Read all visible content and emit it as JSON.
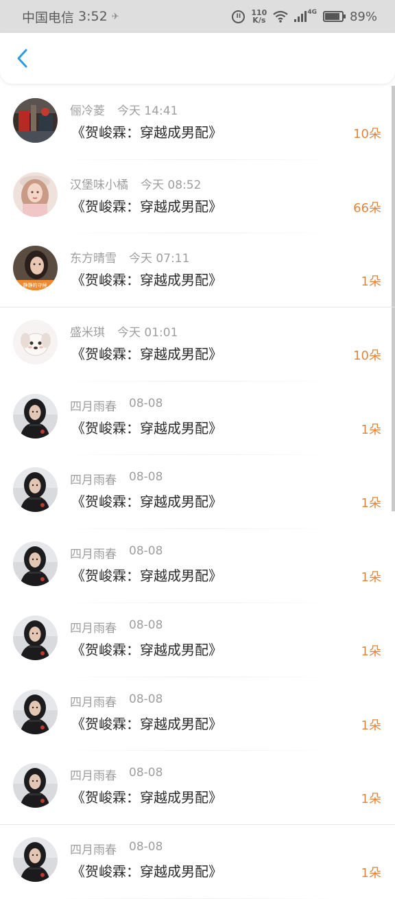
{
  "status_bar": {
    "carrier": "中国电信",
    "time": "3:52",
    "net_speed_value": "110",
    "net_speed_unit": "K/s",
    "network_type": "4G",
    "battery": "89%",
    "battery_level": 0.89
  },
  "header": {
    "back_icon": "chevron-left-icon",
    "accent_color": "#2b9be3"
  },
  "list": {
    "items": [
      {
        "name": "俪冷菱",
        "time": "今天 14:41",
        "book": "《贺峻霖：穿越成男配》",
        "amount": "10朵",
        "avatar": "avatar-photo-street"
      },
      {
        "name": "汉堡味小橘",
        "time": "今天 08:52",
        "book": "《贺峻霖：穿越成男配》",
        "amount": "66朵",
        "avatar": "avatar-photo-girl-pink"
      },
      {
        "name": "东方晴雪",
        "time": "今天 07:11",
        "book": "《贺峻霖：穿越成男配》",
        "amount": "1朵",
        "avatar": "avatar-photo-girl-frame"
      },
      {
        "name": "盛米琪",
        "time": "今天 01:01",
        "book": "《贺峻霖：穿越成男配》",
        "amount": "10朵",
        "avatar": "avatar-cartoon-dog"
      },
      {
        "name": "四月雨春",
        "time": "08-08",
        "book": "《贺峻霖：穿越成男配》",
        "amount": "1朵",
        "avatar": "avatar-photo-hood"
      },
      {
        "name": "四月雨春",
        "time": "08-08",
        "book": "《贺峻霖：穿越成男配》",
        "amount": "1朵",
        "avatar": "avatar-photo-hood"
      },
      {
        "name": "四月雨春",
        "time": "08-08",
        "book": "《贺峻霖：穿越成男配》",
        "amount": "1朵",
        "avatar": "avatar-photo-hood"
      },
      {
        "name": "四月雨春",
        "time": "08-08",
        "book": "《贺峻霖：穿越成男配》",
        "amount": "1朵",
        "avatar": "avatar-photo-hood"
      },
      {
        "name": "四月雨春",
        "time": "08-08",
        "book": "《贺峻霖：穿越成男配》",
        "amount": "1朵",
        "avatar": "avatar-photo-hood"
      },
      {
        "name": "四月雨春",
        "time": "08-08",
        "book": "《贺峻霖：穿越成男配》",
        "amount": "1朵",
        "avatar": "avatar-photo-hood"
      },
      {
        "name": "四月雨春",
        "time": "08-08",
        "book": "《贺峻霖：穿越成男配》",
        "amount": "1朵",
        "avatar": "avatar-photo-hood"
      }
    ]
  },
  "colors": {
    "amount": "#e0853e",
    "name": "#9e9e9e",
    "book": "#2a2a2a",
    "status_bar_bg": "#dedede"
  }
}
